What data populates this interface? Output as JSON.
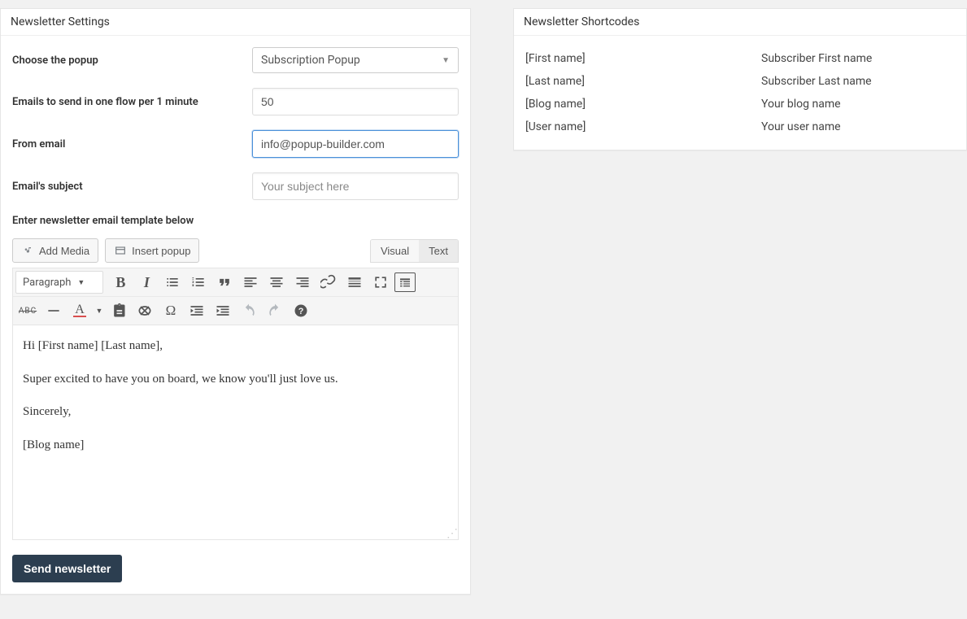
{
  "settings": {
    "title": "Newsletter Settings",
    "choose_popup_label": "Choose the popup",
    "choose_popup_value": "Subscription Popup",
    "emails_flow_label": "Emails to send in one flow per 1 minute",
    "emails_flow_value": "50",
    "from_email_label": "From email",
    "from_email_value": "info@popup-builder.com",
    "subject_label": "Email's subject",
    "subject_placeholder": "Your subject here",
    "template_label": "Enter newsletter email template below",
    "add_media_label": "Add Media",
    "insert_popup_label": "Insert popup",
    "tab_visual": "Visual",
    "tab_text": "Text",
    "paragraph_label": "Paragraph",
    "editor_lines": {
      "l1": "Hi [First name] [Last name],",
      "l2": "Super excited to have you on board, we know you'll just love us.",
      "l3": "Sincerely,",
      "l4": "[Blog name]"
    },
    "send_button": "Send newsletter"
  },
  "shortcodes": {
    "title": "Newsletter Shortcodes",
    "rows": [
      {
        "code": "[First name]",
        "desc": "Subscriber First name"
      },
      {
        "code": "[Last name]",
        "desc": "Subscriber Last name"
      },
      {
        "code": "[Blog name]",
        "desc": "Your blog name"
      },
      {
        "code": "[User name]",
        "desc": "Your user name"
      }
    ]
  }
}
